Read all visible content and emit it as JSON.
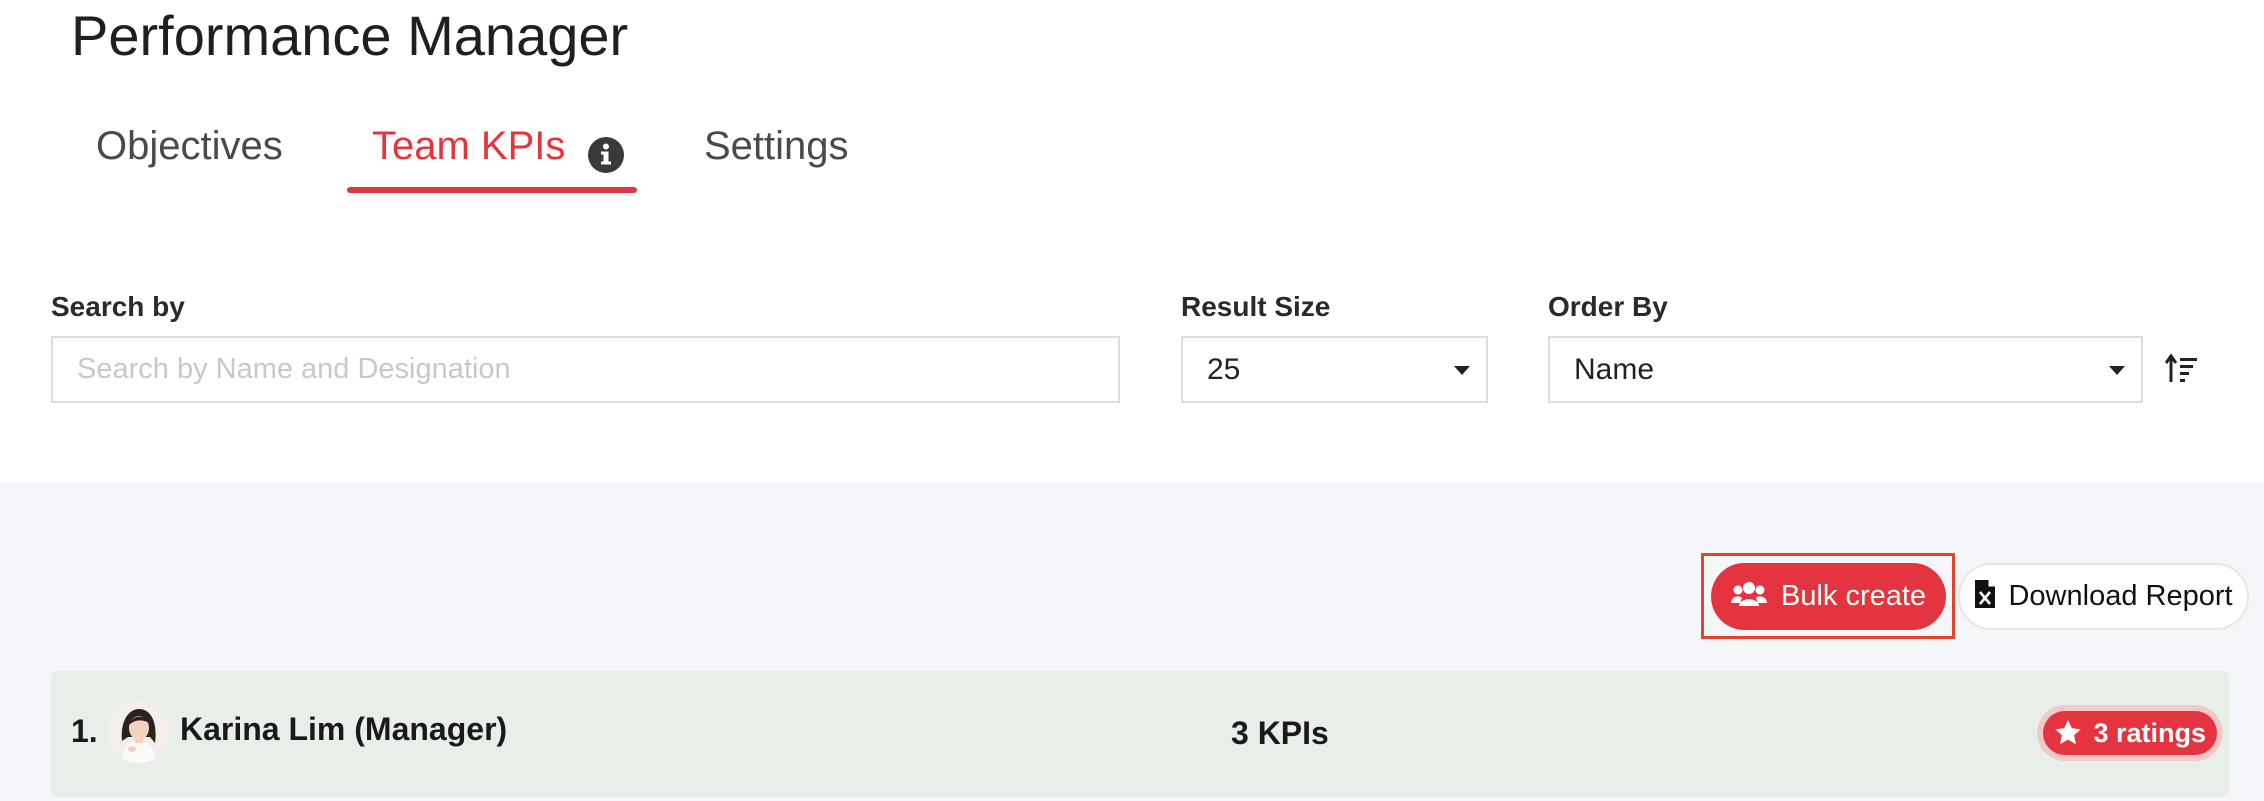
{
  "page": {
    "title": "Performance Manager"
  },
  "tabs": [
    {
      "label": "Objectives",
      "active": false
    },
    {
      "label": "Team KPIs",
      "active": true,
      "icon": "info-icon"
    },
    {
      "label": "Settings",
      "active": false
    }
  ],
  "filters": {
    "search": {
      "label": "Search by",
      "placeholder": "Search by Name and Designation",
      "value": ""
    },
    "result_size": {
      "label": "Result Size",
      "value": "25"
    },
    "order_by": {
      "label": "Order By",
      "value": "Name"
    },
    "sort_icon": "sort-ascending-icon"
  },
  "actions": {
    "bulk_create": {
      "label": "Bulk create",
      "icon": "users-icon"
    },
    "download_report": {
      "label": "Download Report",
      "icon": "excel-file-icon"
    }
  },
  "rows": [
    {
      "number": "1.",
      "name": "Karina Lim (Manager)",
      "kpis": "3 KPIs",
      "ratings": "3 ratings"
    }
  ],
  "colors": {
    "accent": "#e4343f",
    "row_bg": "#e8efe9",
    "section_bg": "#f5f6f9",
    "highlight": "#e2442c"
  }
}
